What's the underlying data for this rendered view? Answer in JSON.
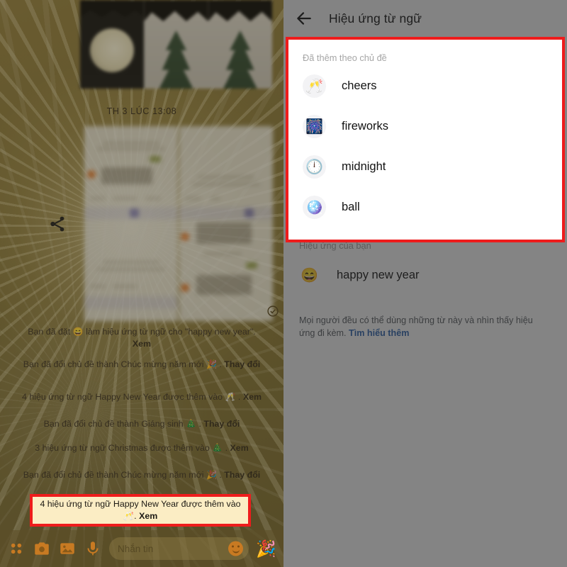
{
  "left_panel": {
    "timestamp": "TH 3 LÚC 13:08",
    "share_icon": "share-icon",
    "delivered_icon": "delivered-check-icon",
    "messages": [
      {
        "id": "m1",
        "text_before": "Bạn đã đặt",
        "emoji": "😄",
        "text_after": "làm hiệu ứng từ ngữ cho \"happy new year\". ",
        "action": "Xem"
      },
      {
        "id": "m2",
        "text_before": "Bạn đã đổi chủ đề thành Chúc mừng năm mới",
        "emoji": "🎉",
        "text_after": ". ",
        "action": "Thay đổi"
      },
      {
        "id": "m3",
        "text_before": "4 hiệu ứng từ ngữ Happy New Year được thêm vào",
        "emoji": "🥂",
        "text_after": ". ",
        "action": "Xem"
      },
      {
        "id": "m4",
        "text_before": "Bạn đã đổi chủ đề thành Giáng sinh",
        "emoji": "🎄",
        "text_after": ". ",
        "action": "Thay đổi"
      },
      {
        "id": "m5",
        "text_before": "3 hiệu ứng từ ngữ Christmas được thêm vào",
        "emoji": "🎄",
        "text_after": ". ",
        "action": "Xem"
      },
      {
        "id": "m6",
        "text_before": "Bạn đã đổi chủ đề thành Chúc mừng năm mới",
        "emoji": "🎉",
        "text_after": ". ",
        "action": "Thay đổi"
      }
    ],
    "highlighted_message": {
      "text_before": "4 hiệu ứng từ ngữ Happy New Year được thêm vào",
      "emoji": "🥂",
      "text_after": ". ",
      "action": "Xem"
    },
    "bottom_bar": {
      "apps_icon": "apps-grid-icon",
      "camera_icon": "camera-icon",
      "gallery_icon": "gallery-icon",
      "mic_icon": "microphone-icon",
      "input_placeholder": "Nhắn tin",
      "emoji_icon": "smiley-icon",
      "sticker_icon": "🎉"
    }
  },
  "right_panel": {
    "header": {
      "back_icon": "back-arrow-icon",
      "title": "Hiệu ứng từ ngữ"
    },
    "theme_section": {
      "label": "Đã thêm theo chủ đề",
      "items": [
        {
          "emoji": "🥂",
          "label": "cheers"
        },
        {
          "emoji": "🎆",
          "label": "fireworks"
        },
        {
          "emoji": "🕛",
          "label": "midnight"
        },
        {
          "emoji": "🪩",
          "label": "ball"
        }
      ]
    },
    "your_section": {
      "label": "Hiệu ứng của bạn",
      "items": [
        {
          "emoji": "😄",
          "label": "happy new year"
        }
      ]
    },
    "footnote": {
      "text": "Mọi người đều có thể dùng những từ này và nhìn thấy hiệu ứng đi kèm. ",
      "link": "Tìm hiểu thêm"
    }
  },
  "annotations": {
    "highlight_color": "#ee1c1c",
    "highlight_fill": "#fbedc4"
  }
}
